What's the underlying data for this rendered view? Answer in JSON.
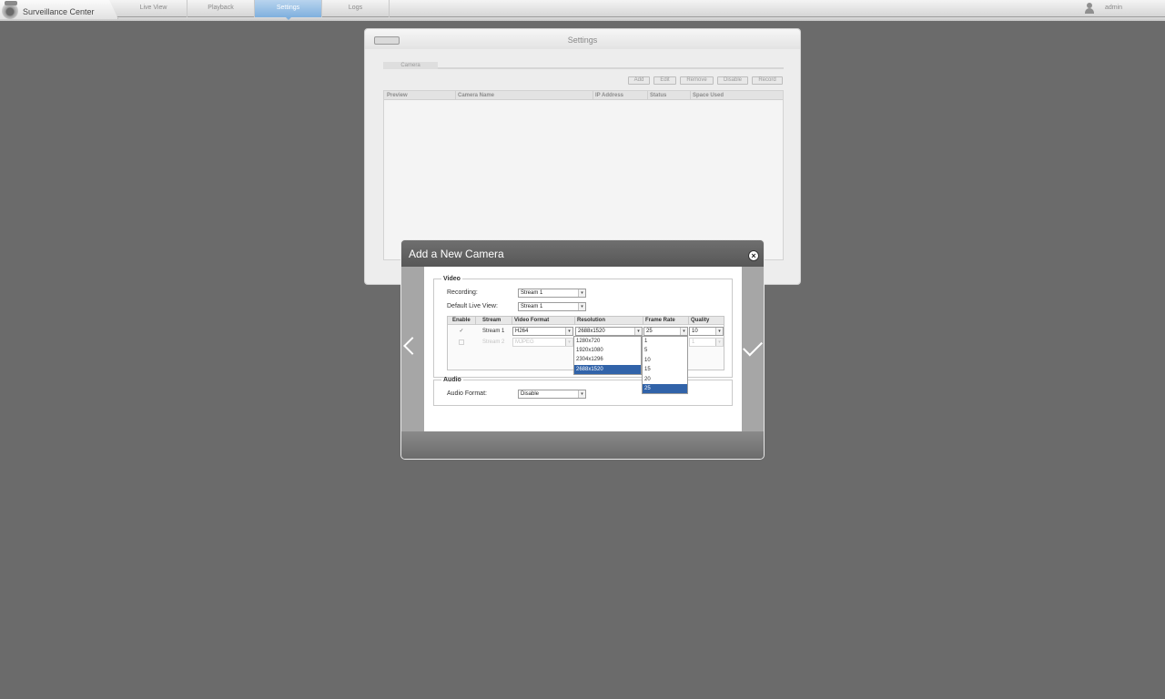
{
  "app": {
    "title": "Surveillance Center",
    "user": "admin",
    "user_icon": "user-icon"
  },
  "nav": {
    "tabs": [
      "Live View",
      "Playback",
      "Settings",
      "Logs"
    ],
    "active": "Settings"
  },
  "settings": {
    "title": "Settings",
    "tab": "Camera",
    "buttons": [
      "Add",
      "Edit",
      "Remove",
      "Disable",
      "Record"
    ],
    "columns": [
      "Preview",
      "Camera Name",
      "IP Address",
      "Status",
      "Space Used"
    ]
  },
  "modal": {
    "title": "Add a New Camera",
    "video": {
      "legend": "Video",
      "recording_label": "Recording:",
      "recording_value": "Stream 1",
      "live_view_label": "Default Live View:",
      "live_view_value": "Stream 1",
      "columns": [
        "Enable",
        "Stream",
        "Video Format",
        "Resolution",
        "Frame Rate",
        "Quality"
      ],
      "rows": [
        {
          "enabled": true,
          "check": "✓",
          "stream": "Stream 1",
          "format": "H264",
          "resolution": "2688x1520",
          "frame_rate": "25",
          "quality": "10"
        },
        {
          "enabled": false,
          "check": "",
          "stream": "Stream 2",
          "format": "MJPEG",
          "resolution": "",
          "frame_rate": "",
          "quality": "1"
        }
      ]
    },
    "resolution_options": [
      "1280x720",
      "1920x1080",
      "2304x1296",
      "2688x1520"
    ],
    "resolution_selected": "2688x1520",
    "frame_rate_options": [
      "1",
      "5",
      "10",
      "15",
      "20",
      "25"
    ],
    "frame_rate_selected": "25",
    "audio": {
      "legend": "Audio",
      "format_label": "Audio Format:",
      "format_value": "Disable"
    }
  },
  "colors": {
    "accent": "#7fb0de",
    "selection": "#3163a9",
    "background": "#6b6b6b"
  }
}
